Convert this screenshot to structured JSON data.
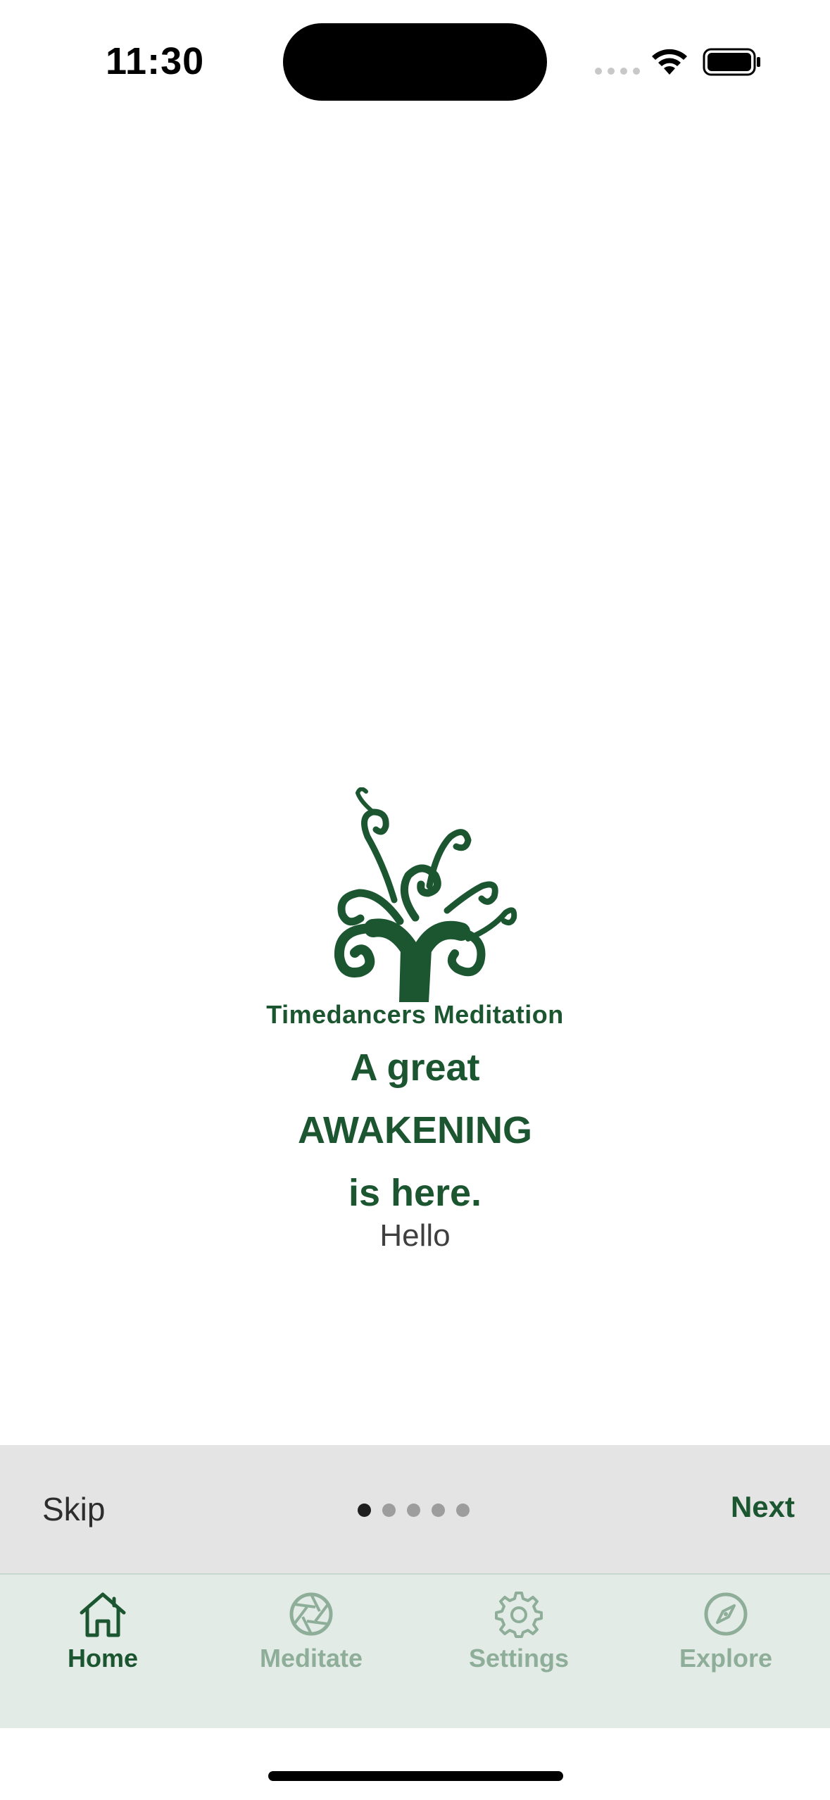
{
  "status_bar": {
    "time": "11:30"
  },
  "app": {
    "name": "Timedancers Meditation",
    "brand_color": "#1c5631"
  },
  "hero": {
    "headline_line1": "A great",
    "headline_line2": "AWAKENING",
    "headline_line3": "is here.",
    "greeting": "Hello"
  },
  "onboarding": {
    "skip_label": "Skip",
    "next_label": "Next",
    "page_count": 5,
    "current_page": 1
  },
  "tabs": [
    {
      "label": "Home",
      "icon": "house-icon",
      "active": true
    },
    {
      "label": "Meditate",
      "icon": "aperture-icon",
      "active": false
    },
    {
      "label": "Settings",
      "icon": "gear-icon",
      "active": false
    },
    {
      "label": "Explore",
      "icon": "compass-icon",
      "active": false
    }
  ]
}
